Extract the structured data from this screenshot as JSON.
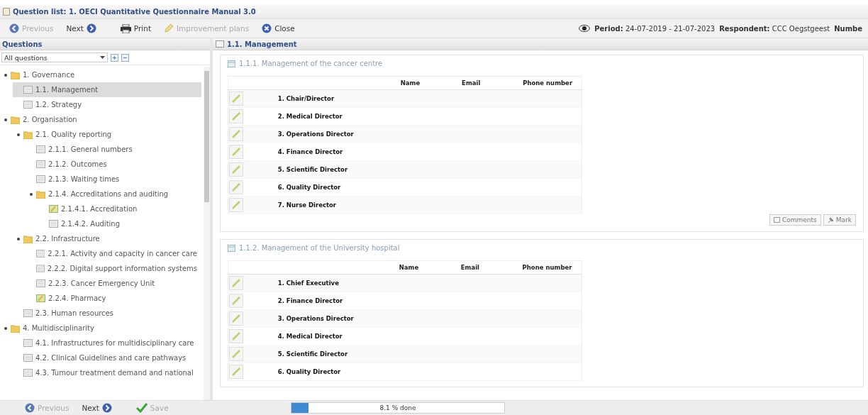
{
  "window": {
    "title": "Question list: 1. OECI Quantitative Questionnaire Manual 3.0"
  },
  "toolbar": {
    "buttons": [
      {
        "label": "Previous",
        "kind": "prev",
        "disabled": true
      },
      {
        "label": "Next",
        "kind": "next",
        "disabled": false
      },
      {
        "label": "Print",
        "kind": "print",
        "disabled": false
      },
      {
        "label": "Improvement plans",
        "kind": "plans",
        "disabled": true
      },
      {
        "label": "Close",
        "kind": "close",
        "disabled": false
      }
    ],
    "info": [
      {
        "label": "Period:",
        "value": "24-07-2019 - 21-07-2023"
      },
      {
        "label": "Respondent:",
        "value": "CCC Oegstgeest"
      },
      {
        "label": "Numbe"
      }
    ]
  },
  "sidebar": {
    "title": "Questions",
    "filter": "All questions",
    "items": [
      {
        "label": "1. Governance",
        "kind": "folder",
        "expanded": true,
        "selected": false,
        "children": [
          {
            "label": "1.1. Management",
            "kind": "page",
            "selected": true
          },
          {
            "label": "1.2. Strategy",
            "kind": "page",
            "selected": false
          }
        ]
      },
      {
        "label": "2. Organisation",
        "kind": "folder",
        "expanded": true,
        "selected": false,
        "children": [
          {
            "label": "2.1. Quality reporting",
            "kind": "folder",
            "expanded": true,
            "selected": false,
            "children": [
              {
                "label": "2.1.1. General numbers",
                "kind": "page",
                "selected": false
              },
              {
                "label": "2.1.2. Outcomes",
                "kind": "page",
                "selected": false
              },
              {
                "label": "2.1.3. Waiting times",
                "kind": "page",
                "selected": false
              },
              {
                "label": "2.1.4. Accreditations and auditing",
                "kind": "folder",
                "expanded": true,
                "selected": false,
                "children": [
                  {
                    "label": "2.1.4.1. Accreditation",
                    "kind": "edited",
                    "selected": false
                  },
                  {
                    "label": "2.1.4.2. Auditing",
                    "kind": "page",
                    "selected": false
                  }
                ]
              }
            ]
          },
          {
            "label": "2.2. Infrastructure",
            "kind": "folder",
            "expanded": true,
            "selected": false,
            "children": [
              {
                "label": "2.2.1. Activity and capacity in cancer care",
                "kind": "page",
                "selected": false
              },
              {
                "label": "2.2.2. Digital support information systems",
                "kind": "page",
                "selected": false
              },
              {
                "label": "2.2.3. Cancer Emergency Unit",
                "kind": "page",
                "selected": false
              },
              {
                "label": "2.2.4. Pharmacy",
                "kind": "edited",
                "selected": false
              }
            ]
          },
          {
            "label": "2.3. Human resources",
            "kind": "page",
            "selected": false
          }
        ]
      },
      {
        "label": "4. Multidisciplinarity",
        "kind": "folder",
        "expanded": true,
        "selected": false,
        "children": [
          {
            "label": "4.1. Infrastructures for multidisciplinary care",
            "kind": "page",
            "selected": false
          },
          {
            "label": "4.2. Clinical Guidelines and care pathways",
            "kind": "page",
            "selected": false
          },
          {
            "label": "4.3. Tumour treatment demand and national",
            "kind": "page",
            "selected": false
          }
        ]
      }
    ]
  },
  "content": {
    "title": "1.1. Management",
    "sections": [
      {
        "title": "1.1.1. Management of the cancer centre",
        "columns": [
          "Name",
          "Email",
          "Phone number"
        ],
        "rows": [
          "1. Chair/Director",
          "2. Medical Director",
          "3. Operations Director",
          "4. Finance Director",
          "5. Scientific Director",
          "6. Quality Director",
          "7. Nurse Director"
        ],
        "buttons": [
          "Comments",
          "Mark"
        ]
      },
      {
        "title": "1.1.2. Management of the University hospital",
        "columns": [
          "Name",
          "Email",
          "Phone number"
        ],
        "rows": [
          "1. Chief Executive",
          "2. Finance Director",
          "3. Operations Director",
          "4. Medical Director",
          "5. Scientific Director",
          "6. Quality Director"
        ]
      }
    ]
  },
  "footer": {
    "buttons": [
      {
        "label": "Previous",
        "kind": "prev",
        "disabled": true
      },
      {
        "label": "Next",
        "kind": "next",
        "disabled": false
      },
      {
        "label": "Save",
        "kind": "save",
        "disabled": true
      }
    ],
    "progress": {
      "level": 0.081,
      "label": "8.1 % done"
    }
  }
}
